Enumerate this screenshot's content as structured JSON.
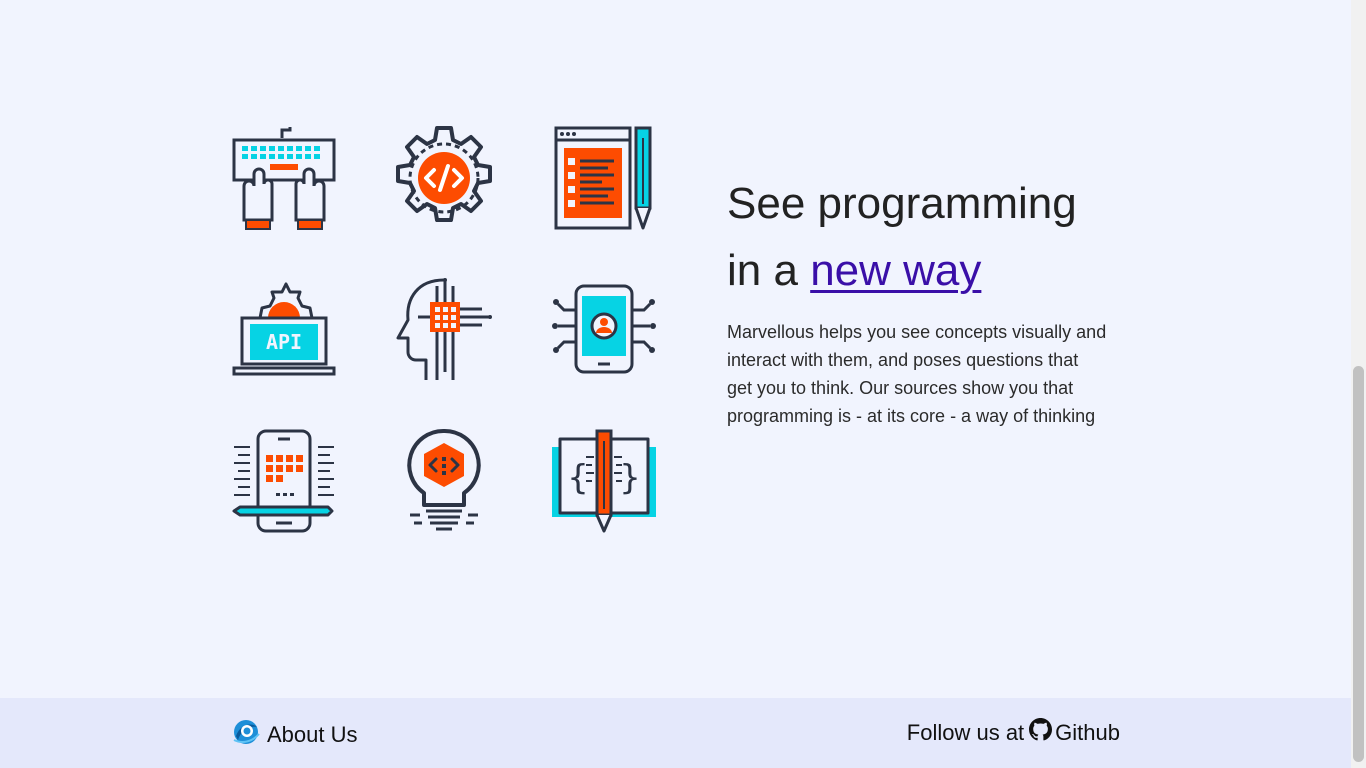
{
  "hero": {
    "headline_part1": "See programming",
    "headline_part2": "in a",
    "headline_link": "new way",
    "description": "Marvellous helps you see concepts visually and interact with them, and poses questions that get you to think. Our sources show you that programming is - at its core - a way of thinking"
  },
  "icons": [
    "keyboard-typing-icon",
    "code-gear-icon",
    "code-editor-pencil-icon",
    "api-laptop-icon",
    "ai-head-chip-icon",
    "mobile-circuit-icon",
    "mobile-app-icon",
    "idea-bulb-code-icon",
    "code-book-icon"
  ],
  "footer": {
    "about_label": "About Us",
    "follow_text": "Follow us at",
    "github_label": "Github"
  },
  "colors": {
    "accent_orange": "#fd4c01",
    "accent_cyan": "#06d3e4",
    "outline": "#2c3445",
    "link": "#3a0fa8",
    "background": "#f1f4fe",
    "footer_bg": "#e4e8fb"
  }
}
